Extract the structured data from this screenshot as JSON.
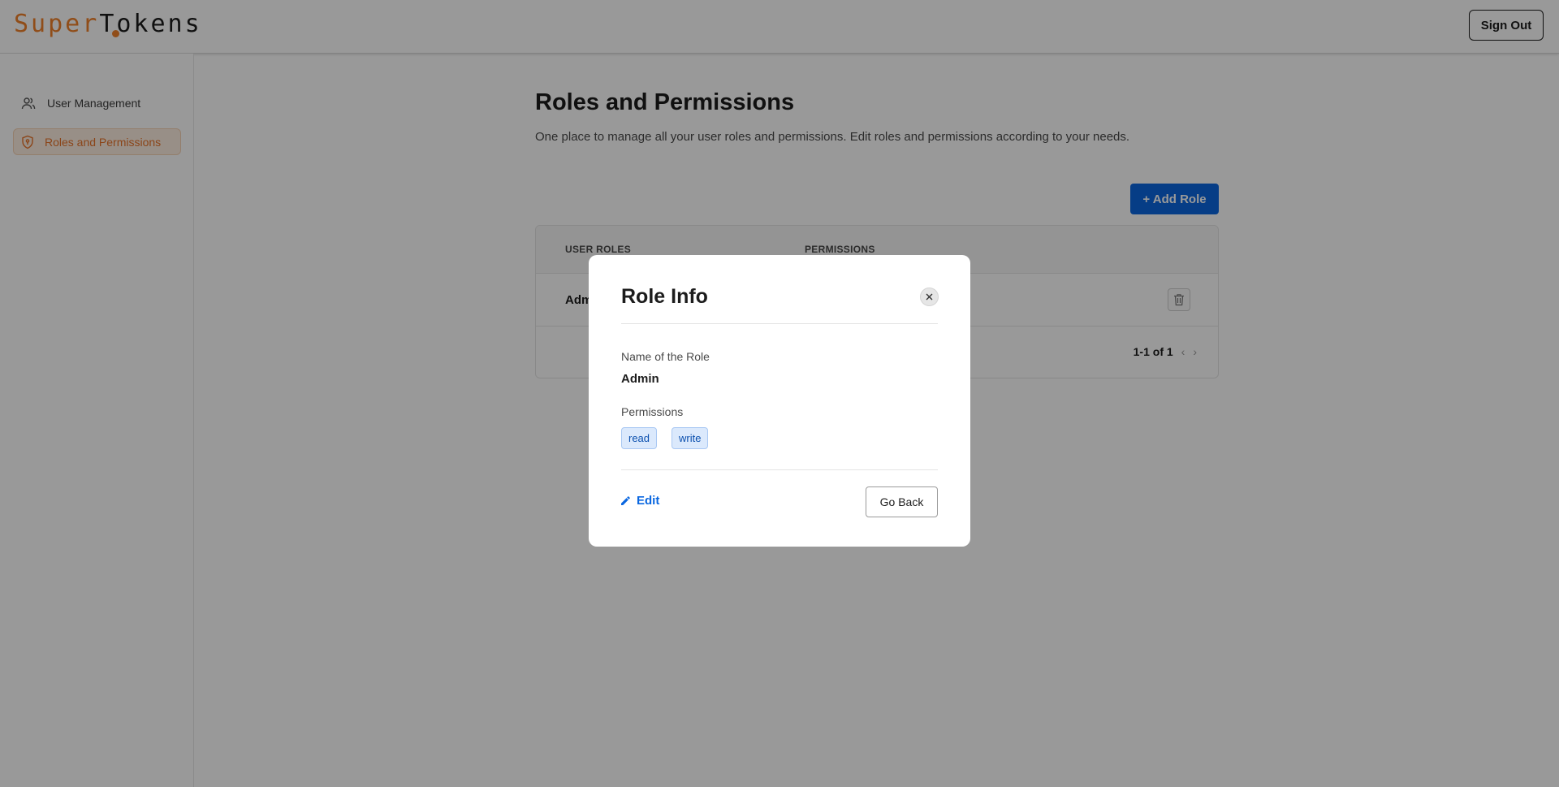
{
  "header": {
    "logo_part1": "Super",
    "logo_part2": "Tokens",
    "sign_out_label": "Sign Out"
  },
  "sidebar": {
    "items": [
      {
        "label": "User Management",
        "icon": "users-icon",
        "active": false
      },
      {
        "label": "Roles and Permissions",
        "icon": "shield-icon",
        "active": true
      }
    ]
  },
  "main": {
    "title": "Roles and Permissions",
    "subtitle": "One place to manage all your user roles and permissions. Edit roles and permissions according to your needs.",
    "add_role_label": "+ Add Role",
    "table": {
      "columns": [
        "USER ROLES",
        "PERMISSIONS"
      ],
      "rows": [
        {
          "role": "Admin"
        }
      ],
      "pagination": "1-1 of 1"
    }
  },
  "modal": {
    "title": "Role Info",
    "name_label": "Name of the Role",
    "name_value": "Admin",
    "permissions_label": "Permissions",
    "permissions": [
      "read",
      "write"
    ],
    "edit_label": "Edit",
    "go_back_label": "Go Back"
  },
  "colors": {
    "brand_orange": "#f0812b",
    "primary_blue": "#0a67e0",
    "chip_bg": "#dbe9fc"
  }
}
